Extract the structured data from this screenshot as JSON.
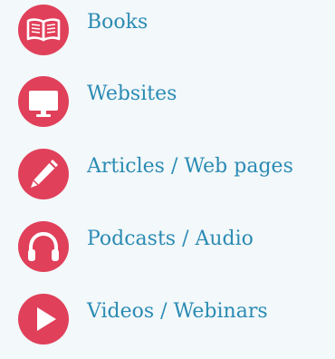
{
  "resources": [
    {
      "label": "Books",
      "icon": "book-icon"
    },
    {
      "label": "Websites",
      "icon": "monitor-icon"
    },
    {
      "label": "Articles / Web pages",
      "icon": "pen-icon"
    },
    {
      "label": "Podcasts / Audio",
      "icon": "headphones-icon"
    },
    {
      "label": "Videos / Webinars",
      "icon": "play-icon"
    }
  ],
  "colors": {
    "accent": "#e0405a",
    "link": "#2b8bb4",
    "background": "#f3f8fa"
  }
}
